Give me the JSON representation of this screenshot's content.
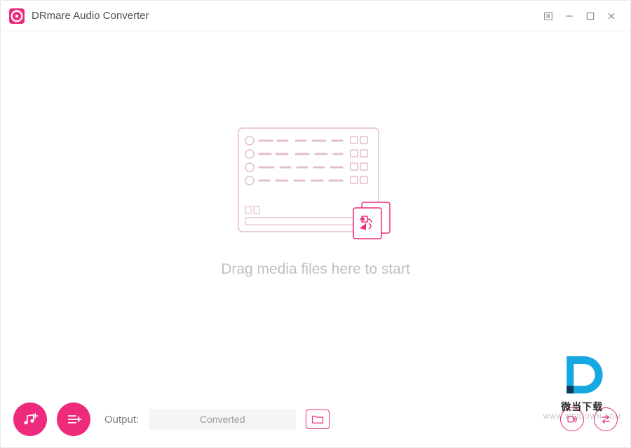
{
  "app": {
    "title": "DRmare Audio Converter"
  },
  "main": {
    "drop_hint": "Drag media files here to start"
  },
  "footer": {
    "output_label": "Output:",
    "output_path": "Converted"
  },
  "watermark": {
    "text": "微当下载",
    "url": "WWW.WEIDOWN.COM"
  },
  "colors": {
    "accent": "#ed2a7b",
    "muted": "#bfbfbf"
  }
}
